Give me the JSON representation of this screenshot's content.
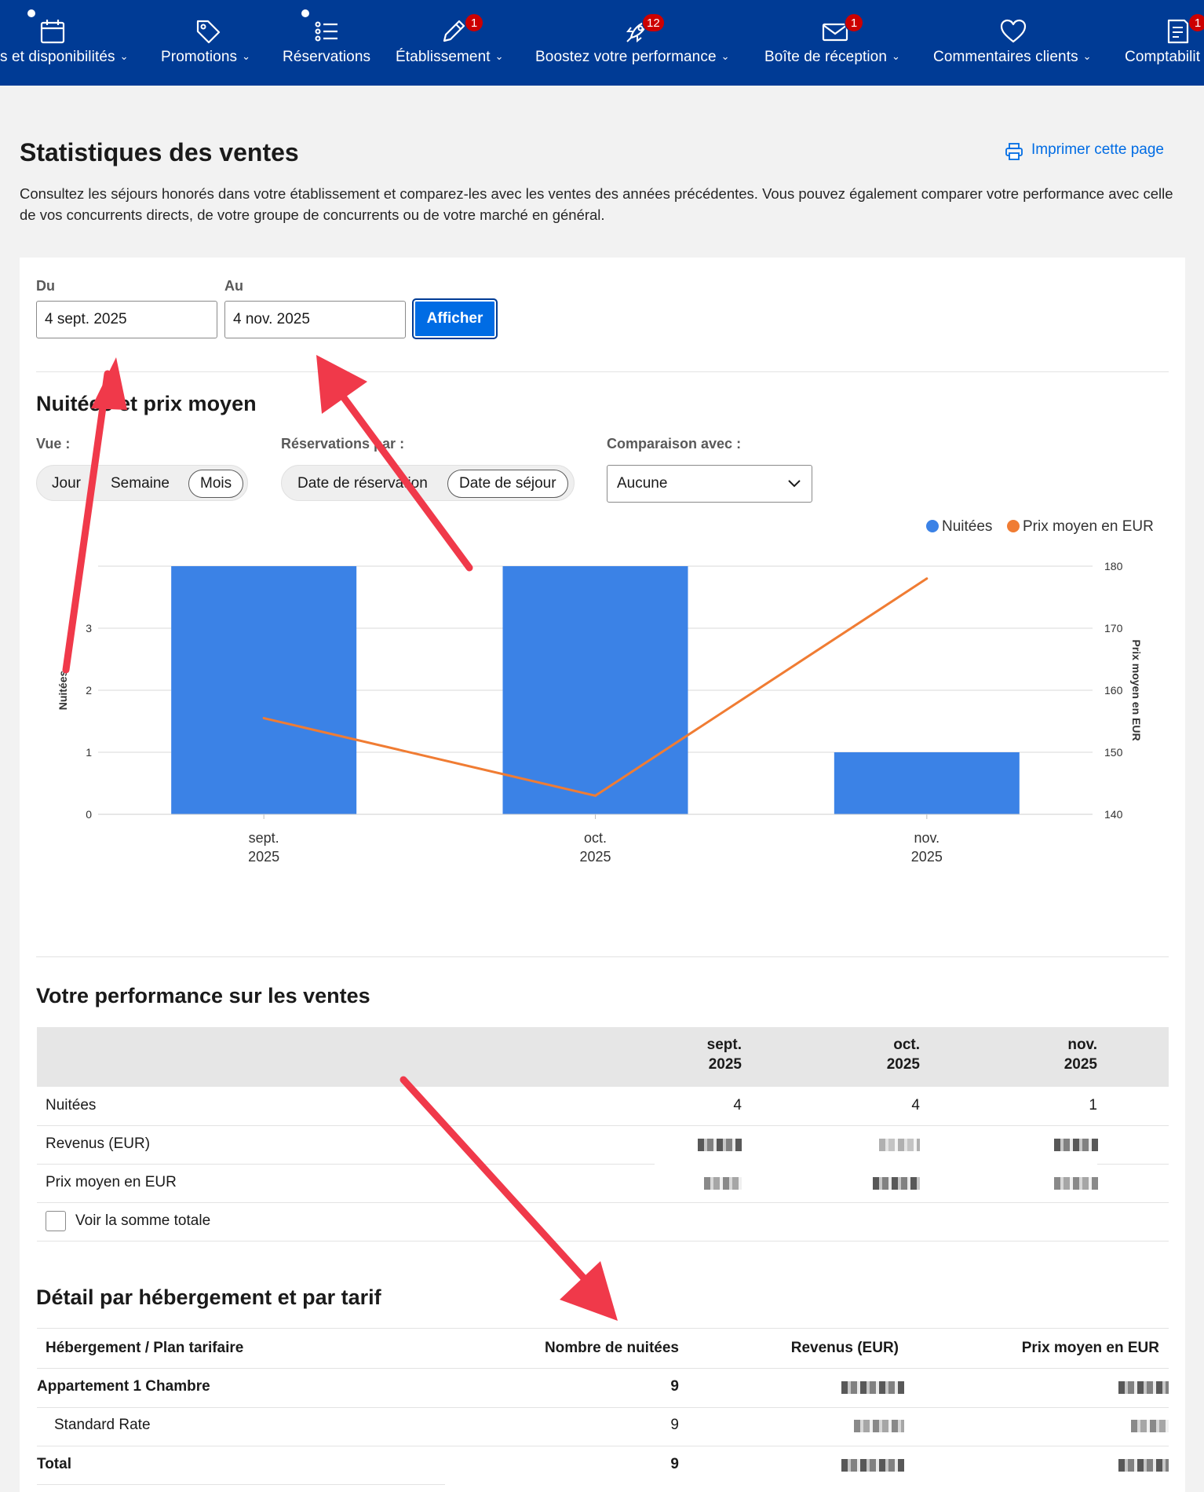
{
  "nav": {
    "items": [
      {
        "label": "s et disponibilités",
        "icon": "calendar-icon",
        "badge": ""
      },
      {
        "label": "Promotions",
        "icon": "tag-icon",
        "badge": ""
      },
      {
        "label": "Réservations",
        "icon": "list-icon",
        "badge": ""
      },
      {
        "label": "Établissement",
        "icon": "pencil-icon",
        "badge": "1"
      },
      {
        "label": "Boostez votre performance",
        "icon": "rocket-icon",
        "badge": "12"
      },
      {
        "label": "Boîte de réception",
        "icon": "envelope-icon",
        "badge": "1"
      },
      {
        "label": "Commentaires clients",
        "icon": "heart-icon",
        "badge": ""
      },
      {
        "label": "Comptabilit",
        "icon": "document-icon",
        "badge": "1"
      }
    ]
  },
  "header": {
    "title": "Statistiques des ventes",
    "print_label": "Imprimer cette page",
    "intro": "Consultez les séjours honorés dans votre établissement et comparez-les avec les ventes des années précédentes. Vous pouvez également comparer votre performance avec celle de vos concurrents directs, de votre groupe de concurrents ou de votre marché en général."
  },
  "filters": {
    "from_label": "Du",
    "from_value": "4 sept. 2025",
    "to_label": "Au",
    "to_value": "4 nov. 2025",
    "submit_label": "Afficher"
  },
  "chart_section": {
    "title": "Nuitées et prix moyen",
    "view_label": "Vue :",
    "view_options": [
      "Jour",
      "Semaine",
      "Mois"
    ],
    "view_selected": "Mois",
    "reservations_label": "Réservations par :",
    "reservations_options": [
      "Date de réservation",
      "Date de séjour"
    ],
    "reservations_selected": "Date de séjour",
    "compare_label": "Comparaison avec :",
    "compare_value": "Aucune"
  },
  "chart_data": {
    "type": "bar",
    "categories": [
      [
        "sept.",
        "2025"
      ],
      [
        "oct.",
        "2025"
      ],
      [
        "nov.",
        "2025"
      ]
    ],
    "series": [
      {
        "name": "Nuitées",
        "type": "bar",
        "axis": "left",
        "values": [
          4,
          4,
          1
        ],
        "color": "#3b82e6"
      },
      {
        "name": "Prix moyen en EUR",
        "type": "line",
        "axis": "right",
        "values": [
          155.5,
          143,
          178
        ],
        "color": "#f07c33"
      }
    ],
    "left_axis": {
      "label": "Nuitées",
      "ticks": [
        "0",
        "1",
        "2",
        "3"
      ],
      "range": [
        0,
        4
      ]
    },
    "right_axis": {
      "label": "Prix moyen en EUR",
      "ticks": [
        "140",
        "150",
        "160",
        "170",
        "180"
      ],
      "range": [
        140,
        180
      ]
    },
    "legend": "top-right",
    "grid": true
  },
  "performance": {
    "title": "Votre performance sur les ventes",
    "columns": [
      [
        "sept.",
        "2025"
      ],
      [
        "oct.",
        "2025"
      ],
      [
        "nov.",
        "2025"
      ]
    ],
    "rows": [
      {
        "label": "Nuitées",
        "values": [
          "4",
          "4",
          "1"
        ]
      },
      {
        "label": "Revenus (EUR)",
        "values": [
          "",
          "",
          ""
        ]
      },
      {
        "label": "Prix moyen en EUR",
        "values": [
          "",
          "",
          ""
        ]
      }
    ],
    "total_checkbox_label": "Voir la somme totale"
  },
  "detail": {
    "title": "Détail par hébergement et par tarif",
    "headers": [
      "Hébergement / Plan tarifaire",
      "Nombre de nuitées",
      "Revenus (EUR)",
      "Prix moyen en EUR"
    ],
    "rows": [
      {
        "label": "Appartement 1 Chambre",
        "nights": "9"
      },
      {
        "label": "Standard Rate",
        "nights": "9"
      },
      {
        "label": "Total",
        "nights": "9"
      }
    ]
  }
}
